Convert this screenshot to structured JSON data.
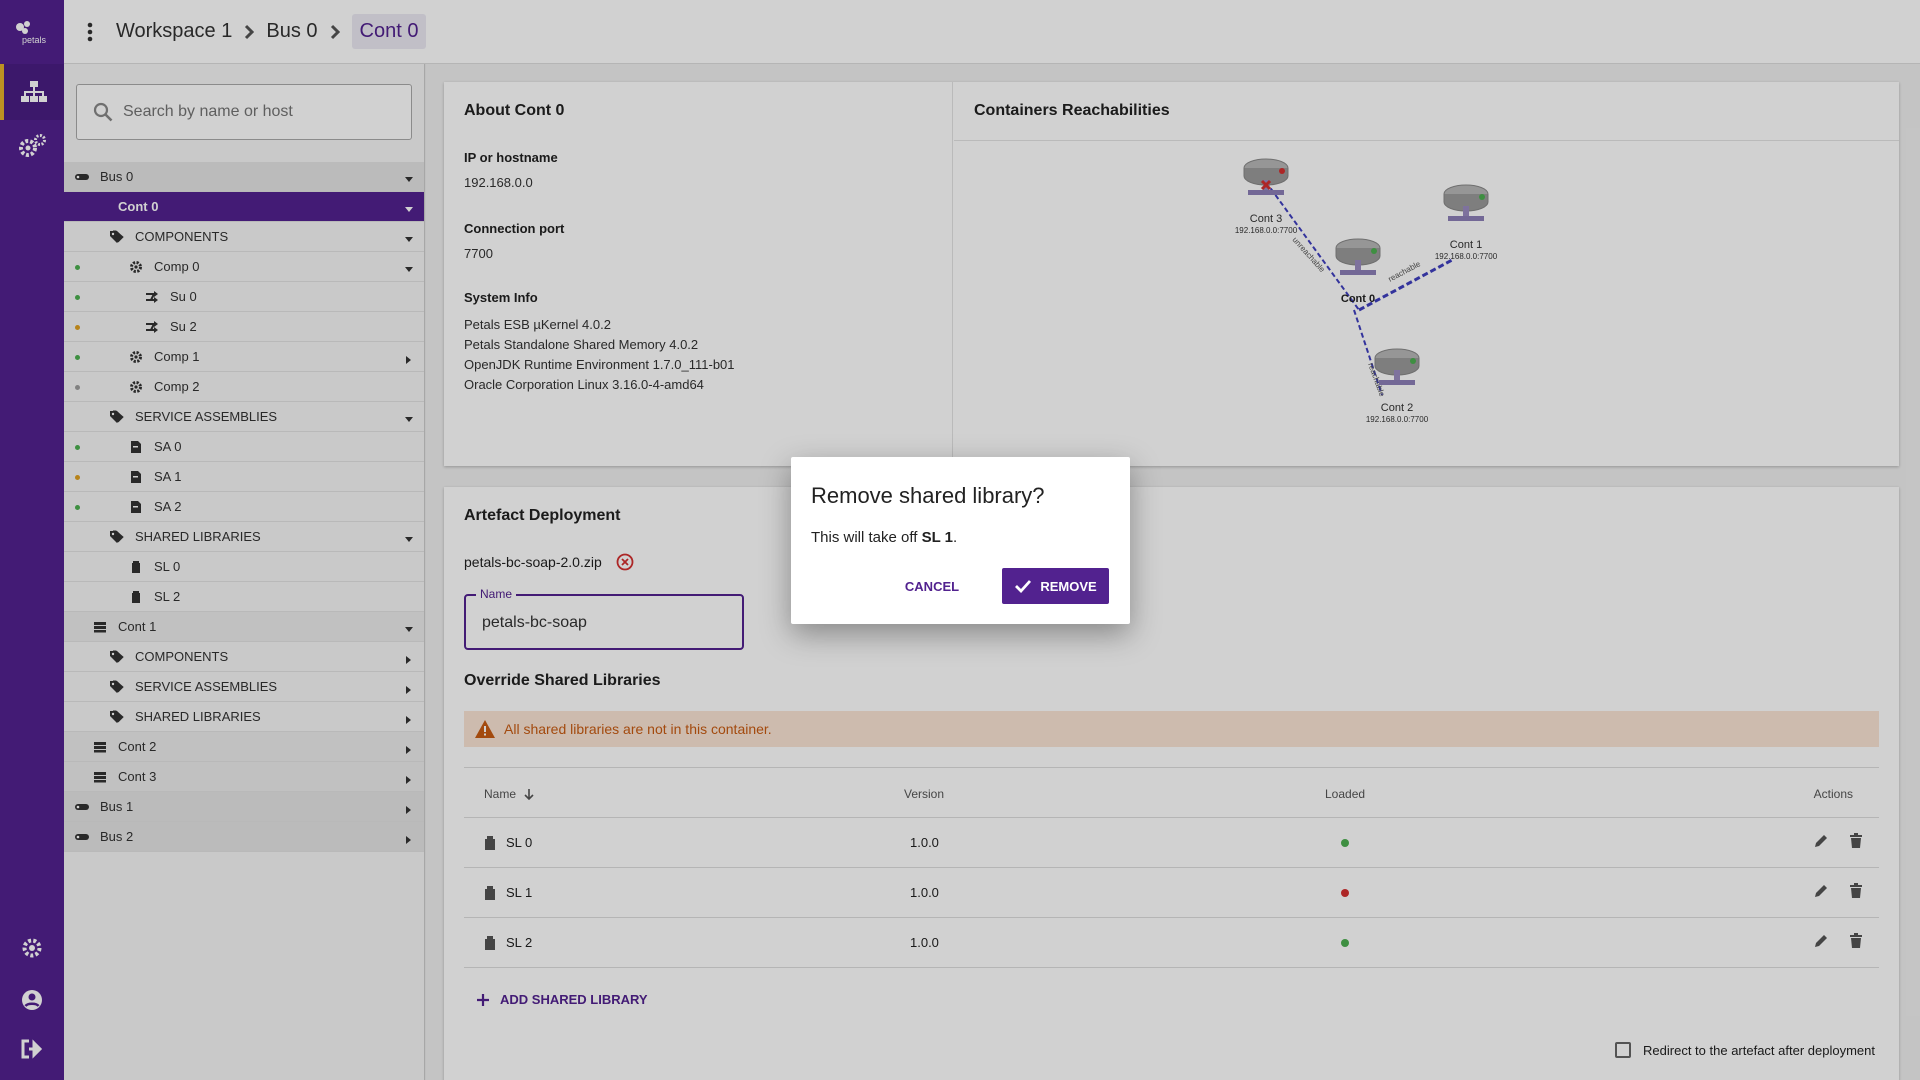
{
  "app": {
    "logo_text": "petals"
  },
  "breadcrumb": {
    "workspace": "Workspace 1",
    "bus": "Bus 0",
    "container": "Cont 0"
  },
  "search": {
    "placeholder": "Search by name or host"
  },
  "tree": [
    {
      "label": "Bus 0",
      "kind": "bus",
      "indent": 0,
      "arrow": "down"
    },
    {
      "label": "Cont 0",
      "kind": "cont",
      "indent": 1,
      "arrow": "down",
      "selected": true
    },
    {
      "label": "COMPONENTS",
      "kind": "cat",
      "indent": 2,
      "arrow": "down"
    },
    {
      "label": "Comp 0",
      "kind": "comp",
      "indent": 3,
      "arrow": "down",
      "status": "#4caf50"
    },
    {
      "label": "Su 0",
      "kind": "su",
      "indent": 4,
      "status": "#4caf50"
    },
    {
      "label": "Su 2",
      "kind": "su",
      "indent": 4,
      "status": "#e0a020"
    },
    {
      "label": "Comp 1",
      "kind": "comp",
      "indent": 3,
      "arrow": "right",
      "status": "#4caf50"
    },
    {
      "label": "Comp 2",
      "kind": "comp",
      "indent": 3,
      "status": "#9e9e9e"
    },
    {
      "label": "SERVICE ASSEMBLIES",
      "kind": "cat",
      "indent": 2,
      "arrow": "down"
    },
    {
      "label": "SA 0",
      "kind": "sa",
      "indent": 3,
      "status": "#4caf50"
    },
    {
      "label": "SA 1",
      "kind": "sa",
      "indent": 3,
      "status": "#e0a020"
    },
    {
      "label": "SA 2",
      "kind": "sa",
      "indent": 3,
      "status": "#4caf50"
    },
    {
      "label": "SHARED LIBRARIES",
      "kind": "cat",
      "indent": 2,
      "arrow": "down"
    },
    {
      "label": "SL 0",
      "kind": "sl",
      "indent": 3
    },
    {
      "label": "SL 2",
      "kind": "sl",
      "indent": 3
    },
    {
      "label": "Cont 1",
      "kind": "cont",
      "indent": 1,
      "arrow": "down"
    },
    {
      "label": "COMPONENTS",
      "kind": "cat",
      "indent": 2,
      "arrow": "right"
    },
    {
      "label": "SERVICE ASSEMBLIES",
      "kind": "cat",
      "indent": 2,
      "arrow": "right"
    },
    {
      "label": "SHARED LIBRARIES",
      "kind": "cat",
      "indent": 2,
      "arrow": "right"
    },
    {
      "label": "Cont 2",
      "kind": "cont",
      "indent": 1,
      "arrow": "right"
    },
    {
      "label": "Cont 3",
      "kind": "cont",
      "indent": 1,
      "arrow": "right"
    },
    {
      "label": "Bus 1",
      "kind": "bus",
      "indent": 0,
      "arrow": "right"
    },
    {
      "label": "Bus 2",
      "kind": "bus",
      "indent": 0,
      "arrow": "right"
    }
  ],
  "about": {
    "title": "About Cont 0",
    "ip_label": "IP or hostname",
    "ip": "192.168.0.0",
    "port_label": "Connection port",
    "port": "7700",
    "sysinfo_label": "System Info",
    "sysinfo": [
      "Petals ESB µKernel 4.0.2",
      "Petals Standalone Shared Memory 4.0.2",
      "OpenJDK Runtime Environment 1.7.0_111-b01",
      "Oracle Corporation Linux 3.16.0-4-amd64"
    ]
  },
  "reach": {
    "title": "Containers Reachabilities",
    "nodes": [
      {
        "name": "Cont 3",
        "ip": "192.168.0.0:7700"
      },
      {
        "name": "Cont 1",
        "ip": "192.168.0.0:7700"
      },
      {
        "name": "Cont 0",
        "ip": ""
      },
      {
        "name": "Cont 2",
        "ip": "192.168.0.0:7700"
      }
    ],
    "edge_labels": [
      "unreachable",
      "reachable",
      "reachable"
    ]
  },
  "deploy": {
    "title": "Artefact Deployment",
    "file": "petals-bc-soap-2.0.zip",
    "name_label": "Name",
    "name_value": "petals-bc-soap",
    "override_title": "Override Shared Libraries",
    "warning": "All shared libraries are not in this container.",
    "columns": [
      "Name",
      "Version",
      "Loaded",
      "Actions"
    ],
    "rows": [
      {
        "name": "SL 0",
        "version": "1.0.0",
        "loaded": "#4caf50"
      },
      {
        "name": "SL 1",
        "version": "1.0.0",
        "loaded": "#d32f2f"
      },
      {
        "name": "SL 2",
        "version": "1.0.0",
        "loaded": "#4caf50"
      }
    ],
    "add_label": "ADD SHARED LIBRARY",
    "redirect_label": "Redirect to the artefact after deployment"
  },
  "dialog": {
    "title": "Remove shared library?",
    "msg_prefix": "This will take off ",
    "msg_target": "SL 1",
    "msg_suffix": ".",
    "cancel": "CANCEL",
    "remove": "REMOVE"
  },
  "colors": {
    "primary": "#52228f",
    "accent": "#e7b22a",
    "warning_bg": "#fbe4d5",
    "warning_fg": "#c75b12"
  }
}
